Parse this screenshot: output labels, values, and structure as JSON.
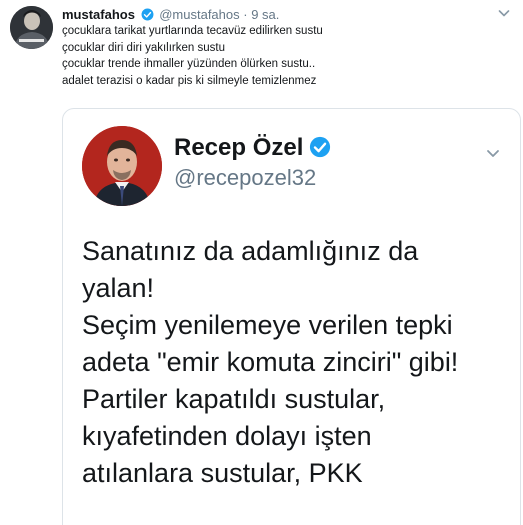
{
  "tweet": {
    "display_name": "mustafahos",
    "handle": "@mustafahos",
    "separator": "·",
    "time": "9 sa.",
    "lines": [
      "çocuklara tarikat yurtlarında tecavüz edilirken sustu",
      "çocuklar diri diri yakılırken sustu",
      "çocuklar trende ihmaller yüzünden ölürken sustu..",
      "adalet terazisi o kadar pis ki silmeyle temizlenmez"
    ]
  },
  "quoted": {
    "display_name": "Recep Özel",
    "handle": "@recepozel32",
    "lines": [
      "Sanatınız da adamlığınız da",
      "yalan!",
      "Seçim yenilemeye verilen tepki",
      "adeta \"emir komuta zinciri\" gibi!",
      "Partiler kapatıldı sustular,",
      "kıyafetinden dolayı işten",
      "atılanlara sustular, PKK"
    ]
  },
  "colors": {
    "verified": "#1da1f2",
    "secondary_text": "#657786",
    "primary_text": "#14171a",
    "border": "#dde3e8"
  },
  "icons": {
    "verified": "verified-badge-icon",
    "menu": "chevron-down-icon"
  }
}
